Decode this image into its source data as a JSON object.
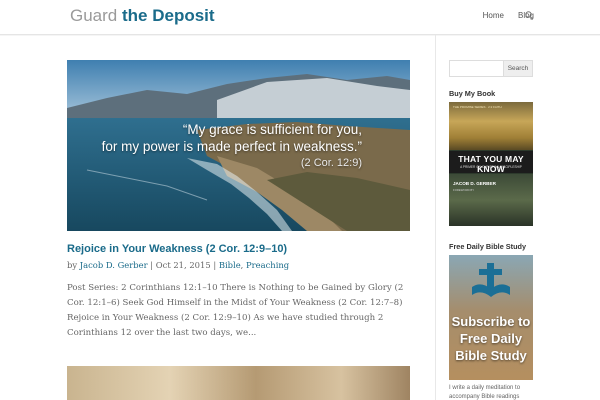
{
  "site": {
    "logo_part1": "Guard",
    "logo_part2": "the Deposit"
  },
  "nav": {
    "items": [
      "Home",
      "Blog"
    ]
  },
  "hero": {
    "quote_line1": "“My grace is sufficient for you,",
    "quote_line2": "for my power is made perfect in weakness.”",
    "quote_ref": "(2 Cor. 12:9)"
  },
  "post": {
    "title": "Rejoice in Your Weakness (2 Cor. 12:9–10)",
    "meta_by": "by",
    "author": "Jacob D. Gerber",
    "date": "Oct 21, 2015",
    "category1": "Bible",
    "category2": "Preaching",
    "excerpt": "Post Series: 2 Corinthians 12:1–10 There is Nothing to be Gained by Glory (2 Cor. 12:1–6) Seek God Himself in the Midst of Your Weakness (2 Cor. 12:7–8) Rejoice in Your Weakness (2 Cor. 12:9–10) As we have studied through 2 Corinthians 12 over the last two days, we..."
  },
  "sidebar": {
    "search_button": "Search",
    "book_widget_title": "Buy My Book",
    "book": {
      "small_caption": "THE PROMISE SERIES · 2:2 FAITH",
      "title": "THAT YOU MAY KNOW",
      "subtitle": "A PRIMER ON CHRISTIAN DISCIPLESHIP",
      "author": "JACOB D. GERBER",
      "author_note": "FOREWORD BY"
    },
    "study_widget_title": "Free Daily Bible Study",
    "promo_line1": "Subscribe to",
    "promo_line2": "Free Daily",
    "promo_line3": "Bible Study",
    "study_note": "I write a daily meditation to accompany Bible readings"
  },
  "colors": {
    "accent": "#1a6b8a",
    "text": "#666666"
  }
}
